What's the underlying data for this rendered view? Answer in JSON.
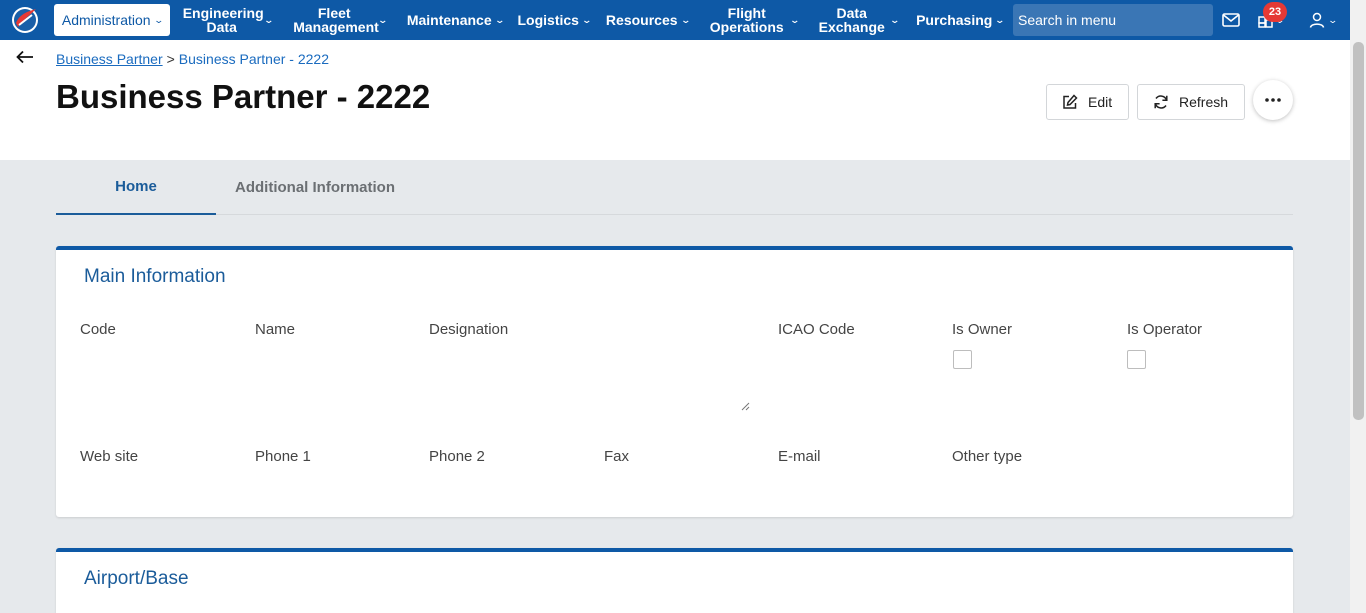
{
  "nav": {
    "items": [
      {
        "label": "Administration",
        "active": true
      },
      {
        "label": "Engineering Data"
      },
      {
        "label": "Fleet Management"
      },
      {
        "label": "Maintenance"
      },
      {
        "label": "Logistics"
      },
      {
        "label": "Resources"
      },
      {
        "label": "Flight Operations"
      },
      {
        "label": "Data Exchange"
      },
      {
        "label": "Purchasing"
      }
    ],
    "search_placeholder": "Search in menu",
    "notification_count": "23",
    "icons": [
      "mail-icon",
      "notifications-icon",
      "user-icon"
    ]
  },
  "breadcrumb": {
    "parent": "Business Partner",
    "separator": ">",
    "current": "Business Partner - 2222"
  },
  "page": {
    "title": "Business Partner - 2222",
    "edit_label": "Edit",
    "refresh_label": "Refresh"
  },
  "tabs": [
    {
      "label": "Home",
      "active": true
    },
    {
      "label": "Additional Information"
    }
  ],
  "main_info": {
    "title": "Main Information",
    "row1": [
      "Code",
      "Name",
      "Designation",
      "ICAO Code",
      "Is Owner",
      "Is Operator"
    ],
    "row2": [
      "Web site",
      "Phone 1",
      "Phone 2",
      "Fax",
      "E-mail",
      "Other type"
    ],
    "is_owner_checked": false,
    "is_operator_checked": false
  },
  "airport_base": {
    "title": "Airport/Base"
  },
  "colors": {
    "brand": "#0e59a6",
    "accent_text": "#1b5c9a",
    "badge": "#e53935"
  }
}
